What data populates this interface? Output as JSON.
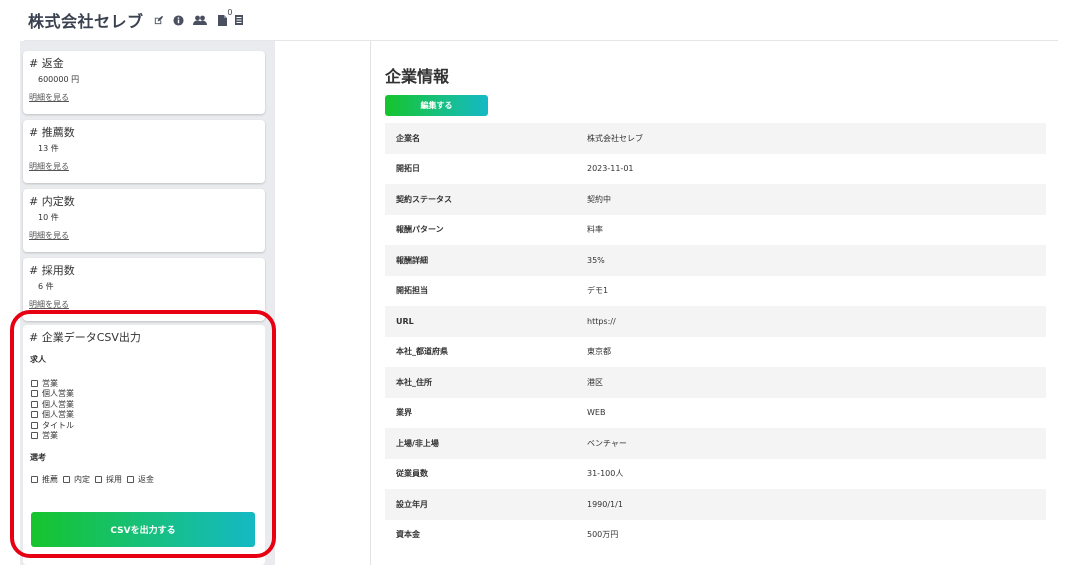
{
  "header": {
    "company_name": "株式会社セレブ",
    "doc_count": "0",
    "icons": [
      "edit-icon",
      "info-icon",
      "users-icon",
      "document-icon",
      "list-icon"
    ]
  },
  "stats": [
    {
      "title": "# 返金",
      "value": "600000 円",
      "link": "明細を見る"
    },
    {
      "title": "# 推薦数",
      "value": "13 件",
      "link": "明細を見る"
    },
    {
      "title": "# 内定数",
      "value": "10 件",
      "link": "明細を見る"
    },
    {
      "title": "# 採用数",
      "value": "6 件",
      "link": "明細を見る"
    }
  ],
  "csv_export": {
    "title": "# 企業データCSV出力",
    "jobs_label": "求人",
    "jobs": [
      "営業",
      "個人営業",
      "個人営業",
      "個人営業",
      "タイトル",
      "営業"
    ],
    "selection_label": "選考",
    "selection": [
      "推薦",
      "内定",
      "採用",
      "返金"
    ],
    "button_label": "CSVを出力する"
  },
  "company_info": {
    "section_title": "企業情報",
    "edit_label": "編集する",
    "rows": [
      {
        "label": "企業名",
        "value": "株式会社セレブ"
      },
      {
        "label": "開拓日",
        "value": "2023-11-01"
      },
      {
        "label": "契約ステータス",
        "value": "契約中"
      },
      {
        "label": "報酬パターン",
        "value": "料率"
      },
      {
        "label": "報酬詳細",
        "value": "35%"
      },
      {
        "label": "開拓担当",
        "value": "デモ1"
      },
      {
        "label": "URL",
        "value": "https://"
      },
      {
        "label": "本社_都道府県",
        "value": "東京都"
      },
      {
        "label": "本社_住所",
        "value": "港区"
      },
      {
        "label": "業界",
        "value": "WEB"
      },
      {
        "label": "上場/非上場",
        "value": "ベンチャー"
      },
      {
        "label": "従業員数",
        "value": "31-100人"
      },
      {
        "label": "設立年月",
        "value": "1990/1/1"
      },
      {
        "label": "資本金",
        "value": "500万円"
      }
    ]
  },
  "colors": {
    "accent_start": "#16c42c",
    "accent_end": "#14b9c4",
    "highlight": "#e60012"
  }
}
